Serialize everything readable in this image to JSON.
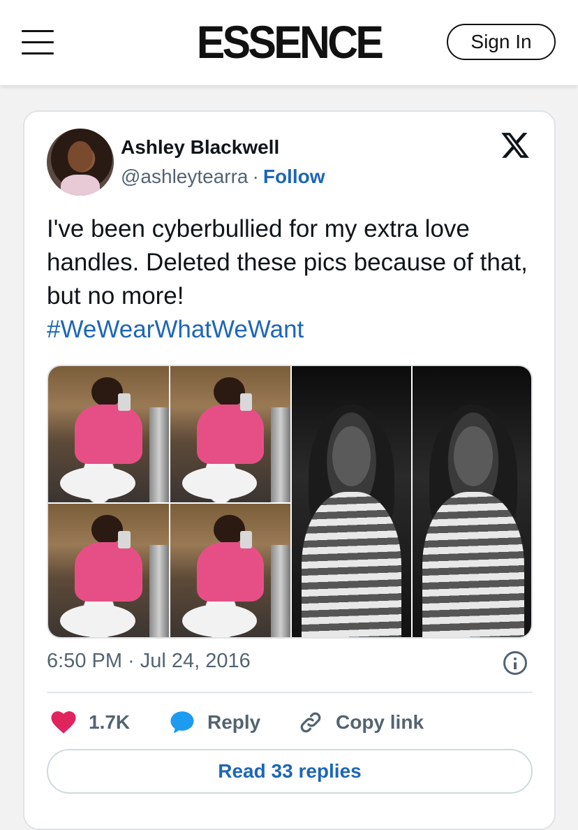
{
  "header": {
    "logo": "ESSENCE",
    "sign_in_label": "Sign In",
    "menu_icon": "hamburger-menu-icon"
  },
  "tweet": {
    "author_name": "Ashley Blackwell",
    "handle": "@ashleytearra",
    "separator": "·",
    "follow_label": "Follow",
    "platform_icon": "x-logo-icon",
    "text": "I've been cyberbullied for my extra love handles. Deleted these pics because of that, but no more!",
    "hashtag": "#WeWearWhatWeWant",
    "timestamp": "6:50 PM · Jul 24, 2016",
    "info_icon": "info-icon",
    "likes": "1.7K",
    "reply_label": "Reply",
    "copy_link_label": "Copy link",
    "read_replies_label": "Read 33 replies"
  },
  "colors": {
    "link_blue": "#1d66b8",
    "like_pink": "#e0245e",
    "reply_blue": "#1d9bf0",
    "text_dark": "#0f1419",
    "text_muted": "#536471"
  }
}
